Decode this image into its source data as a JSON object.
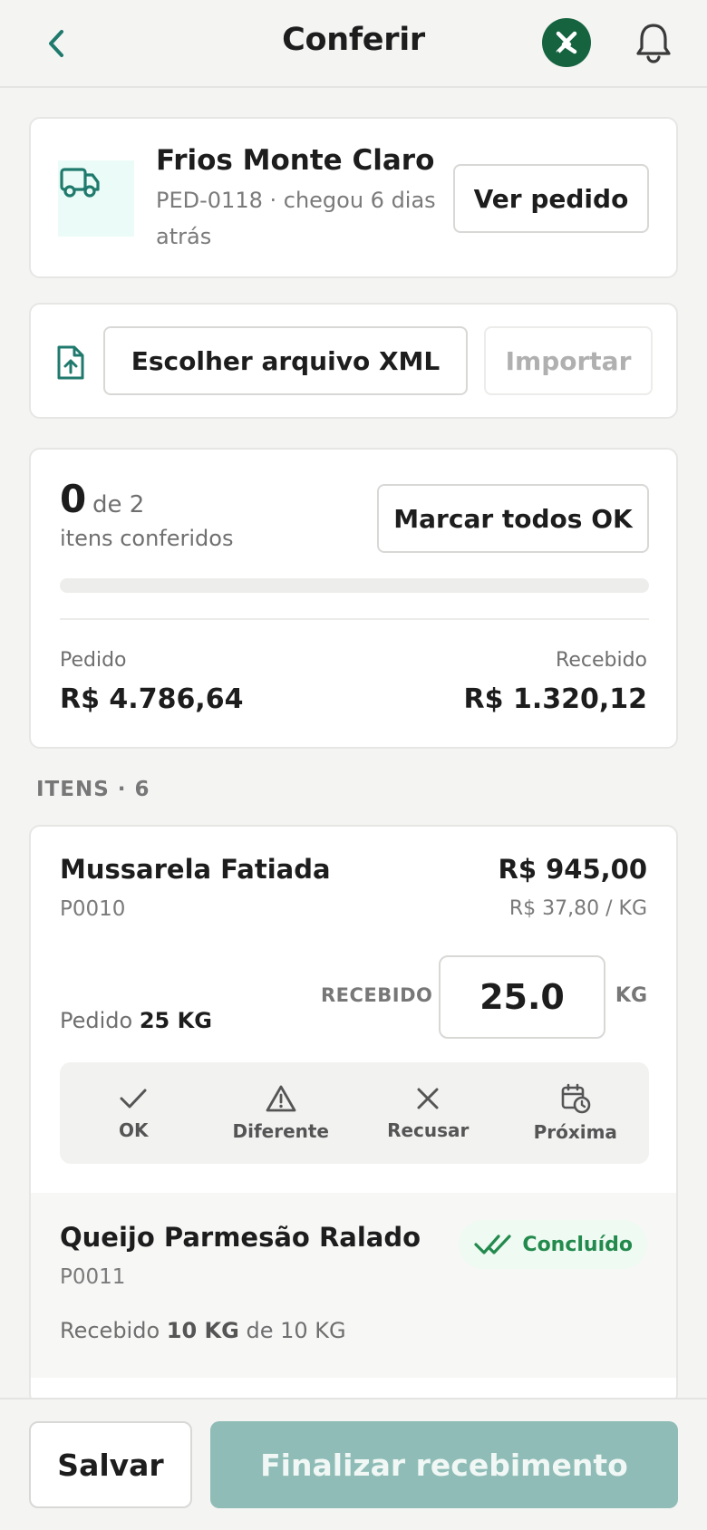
{
  "header": {
    "title": "Conferir",
    "back_icon": "chevron-left-icon",
    "whatsapp_icon": "whatsapp-logo-icon",
    "bell_icon": "bell-icon"
  },
  "supplier": {
    "name": "Frios Monte Claro",
    "meta": "PED-0118 · chegou 6 dias atrás",
    "view_order_label": "Ver pedido"
  },
  "xml": {
    "choose_label": "Escolher arquivo XML",
    "import_label": "Importar"
  },
  "summary": {
    "checked": "0",
    "of_total": "de 2",
    "label": "itens conferidos",
    "mark_all_label": "Marcar todos OK",
    "progress_fraction": 0,
    "ordered_label": "Pedido",
    "ordered_value": "R$ 4.786,64",
    "received_label": "Recebido",
    "received_value": "R$ 1.320,12"
  },
  "items_heading": "ITENS · 6",
  "items": [
    {
      "name": "Mussarela Fatiada",
      "code": "P0010",
      "total": "R$ 945,00",
      "unit_price": "R$ 37,80 / KG",
      "ordered_prefix": "Pedido",
      "ordered_qty": "25 KG",
      "received_label": "RECEBIDO",
      "received_value": "25.0",
      "unit": "KG",
      "actions": [
        {
          "label": "OK",
          "icon": "check-icon"
        },
        {
          "label": "Diferente",
          "icon": "warning-triangle-icon"
        },
        {
          "label": "Recusar",
          "icon": "x-icon"
        },
        {
          "label": "Próxima",
          "icon": "calendar-clock-icon"
        }
      ]
    },
    {
      "name": "Queijo Parmesão Ralado",
      "code": "P0011",
      "status": "Concluído",
      "received_prefix": "Recebido",
      "received_qty": "10 KG",
      "received_suffix": "de 10 KG"
    }
  ],
  "footer": {
    "save_label": "Salvar",
    "finish_label": "Finalizar recebimento"
  },
  "colors": {
    "brand_green": "#15633f",
    "accent_teal": "#1f7a6d",
    "finish_disabled": "#8fbcb6",
    "success": "#238a4d"
  }
}
